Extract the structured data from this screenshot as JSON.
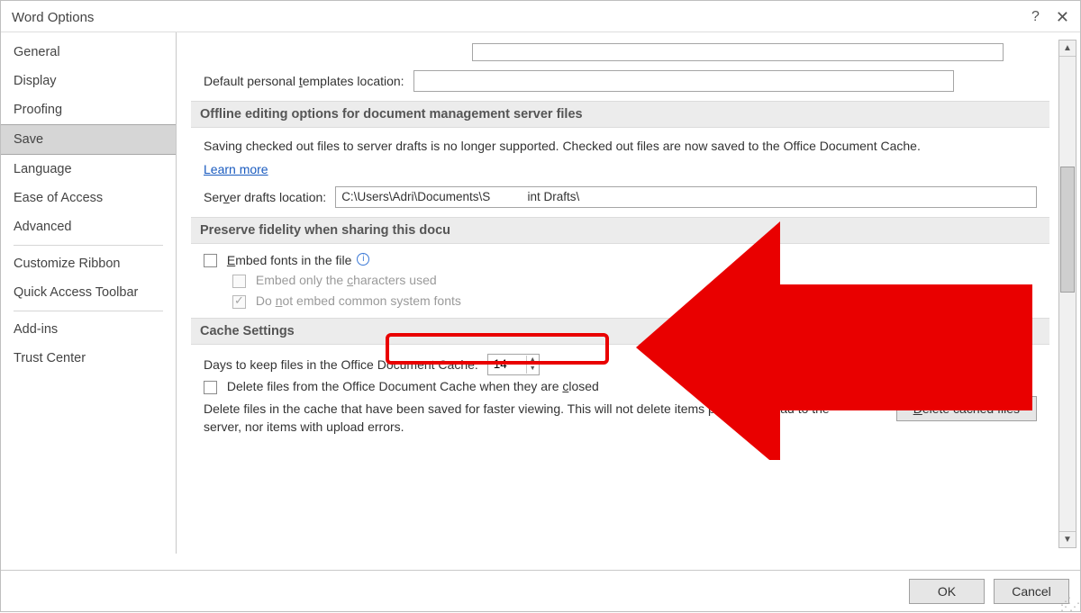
{
  "dialog": {
    "title": "Word Options"
  },
  "sidebar": {
    "items": [
      {
        "label": "General"
      },
      {
        "label": "Display"
      },
      {
        "label": "Proofing"
      },
      {
        "label": "Save",
        "selected": true
      },
      {
        "label": "Language"
      },
      {
        "label": "Ease of Access"
      },
      {
        "label": "Advanced"
      },
      {
        "label": "Customize Ribbon"
      },
      {
        "label": "Quick Access Toolbar"
      },
      {
        "label": "Add-ins"
      },
      {
        "label": "Trust Center"
      }
    ]
  },
  "templates": {
    "label_pre": "Default personal ",
    "label_u": "t",
    "label_post": "emplates location:",
    "value": ""
  },
  "section_offline": {
    "header": "Offline editing options for document management server files",
    "body": "Saving checked out files to server drafts is no longer supported. Checked out files are now saved to the Office Document Cache.",
    "learn_more": "Learn more",
    "server_drafts_pre": "Ser",
    "server_drafts_u": "v",
    "server_drafts_post": "er drafts location:",
    "server_drafts_value": "C:\\Users\\Adri\\Documents\\S           int Drafts\\"
  },
  "section_preserve": {
    "header": "Preserve fidelity when sharing this docu",
    "embed_u": "E",
    "embed_post": "mbed fonts in the file",
    "embed_only_pre": "Embed only the ",
    "embed_only_u": "c",
    "embed_only_post": "haracters used",
    "do_not_pre": "Do ",
    "do_not_u": "n",
    "do_not_post": "ot embed common system fonts"
  },
  "section_cache": {
    "header": "Cache Settings",
    "days_label": "Days to keep files in the Office Document Cache:",
    "days_value": "14",
    "delete_closed_pre": "Delete files from the Office Document Cache when they are ",
    "delete_closed_u": "c",
    "delete_closed_post": "losed",
    "desc": "Delete files in the cache that have been saved for faster viewing. This will not delete items pending upload to the server, nor items with upload errors.",
    "delete_btn_u": "D",
    "delete_btn_post": "elete cached files"
  },
  "footer": {
    "ok": "OK",
    "cancel": "Cancel"
  }
}
